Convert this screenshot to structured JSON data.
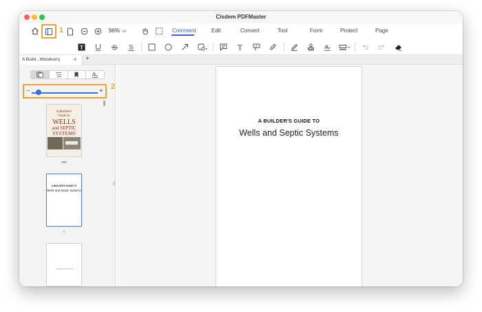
{
  "window": {
    "title": "Cisdem PDFMaster"
  },
  "toolbar": {
    "zoom_level": "96%",
    "tabs": [
      {
        "label": "Comment",
        "active": true
      },
      {
        "label": "Edit"
      },
      {
        "label": "Convert"
      },
      {
        "label": "Tool"
      },
      {
        "label": "Form"
      },
      {
        "label": "Protect"
      },
      {
        "label": "Page"
      }
    ]
  },
  "annotations": {
    "step1": "1",
    "step2": "2"
  },
  "document_tab": {
    "label": "A Build...Woodson)"
  },
  "sidebar": {
    "thumb_zoom_percent": 8,
    "thumbnails": [
      {
        "label": "cvr",
        "cover_title_lines": [
          "A Builder's",
          "Guide to",
          "WELLS",
          "and SEPTIC",
          "SYSTEMS"
        ]
      },
      {
        "label": "i",
        "line1": "A BUILDER'S GUIDE TO",
        "line2": "Wells and Septic Systems"
      },
      {
        "label": ""
      }
    ]
  },
  "page": {
    "heading": "A BUILDER'S GUIDE TO",
    "subheading": "Wells and Septic Systems"
  },
  "colors": {
    "accent": "#3b5bdb",
    "highlight": "#f0a030"
  }
}
